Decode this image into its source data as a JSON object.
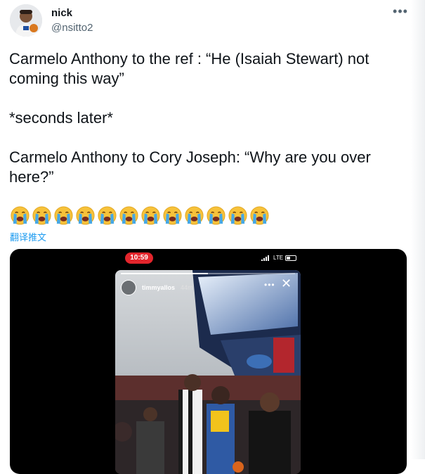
{
  "author": {
    "name": "nick",
    "handle": "@nsitto2"
  },
  "more_menu": {
    "label": "•••"
  },
  "tweet": {
    "lines": [
      "Carmelo Anthony to the ref : “He (Isaiah Stewart) not coming this way”",
      "*seconds later*",
      "Carmelo Anthony to Cory Joseph: “Why are you over here?”"
    ],
    "emojis": [
      "loudly-crying-face",
      "loudly-crying-face",
      "loudly-crying-face",
      "loudly-crying-face",
      "loudly-crying-face",
      "loudly-crying-face",
      "loudly-crying-face",
      "loudly-crying-face",
      "loudly-crying-face",
      "loudly-crying-face",
      "loudly-crying-face",
      "loudly-crying-face"
    ],
    "translate_label": "翻译推文"
  },
  "media": {
    "phone_status": {
      "time": "10:59",
      "network": "LTE"
    },
    "story": {
      "username": "timmyallos",
      "age": "44m",
      "progress": 0.5
    }
  },
  "colors": {
    "link": "#1d9bf0",
    "secondary_text": "#536471",
    "status_pill": "#e3252c"
  }
}
